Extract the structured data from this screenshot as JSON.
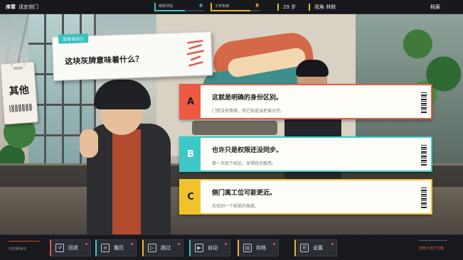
{
  "topbar": {
    "chapter_label": "序章",
    "chapter_title": "请走侧门",
    "stat1": {
      "label": "绩效评估",
      "value": "6",
      "level": 0.6,
      "color": "#3fc7c3"
    },
    "stat2": {
      "label": "工作负荷",
      "value": "8",
      "level": 0.8,
      "color": "#f0b632"
    },
    "age": "29 岁",
    "view": "视角 林默",
    "save": "档案"
  },
  "badge": {
    "name": "其他"
  },
  "dialogue": {
    "tag": "没有说出口",
    "question": "这块灰牌意味着什么？"
  },
  "choices": [
    {
      "letter": "A",
      "main": "这就是明确的身份区别。",
      "sub": "门禁没有情绪，但它知道该把谁分开。",
      "color": "#ec5a44"
    },
    {
      "letter": "B",
      "main": "也许只是权限还没同步。",
      "sub": "第一天就下结论，显得我太敏感。",
      "color": "#3cc8c6"
    },
    {
      "letter": "C",
      "main": "侧门离工位可能更近。",
      "sub": "先找到一个能笑的角度。",
      "color": "#f2c22a"
    }
  ],
  "toolbar": {
    "hint_left": "内容等待中",
    "hint_right": "滑条对话下空格",
    "undo": "回退",
    "history": "履历",
    "skip": "跳过",
    "auto": "自动",
    "save": "存档",
    "settings": "设置"
  },
  "colors": {
    "accent_red": "#e0584a",
    "accent_teal": "#3fc7c3",
    "accent_yellow": "#f0b632"
  }
}
